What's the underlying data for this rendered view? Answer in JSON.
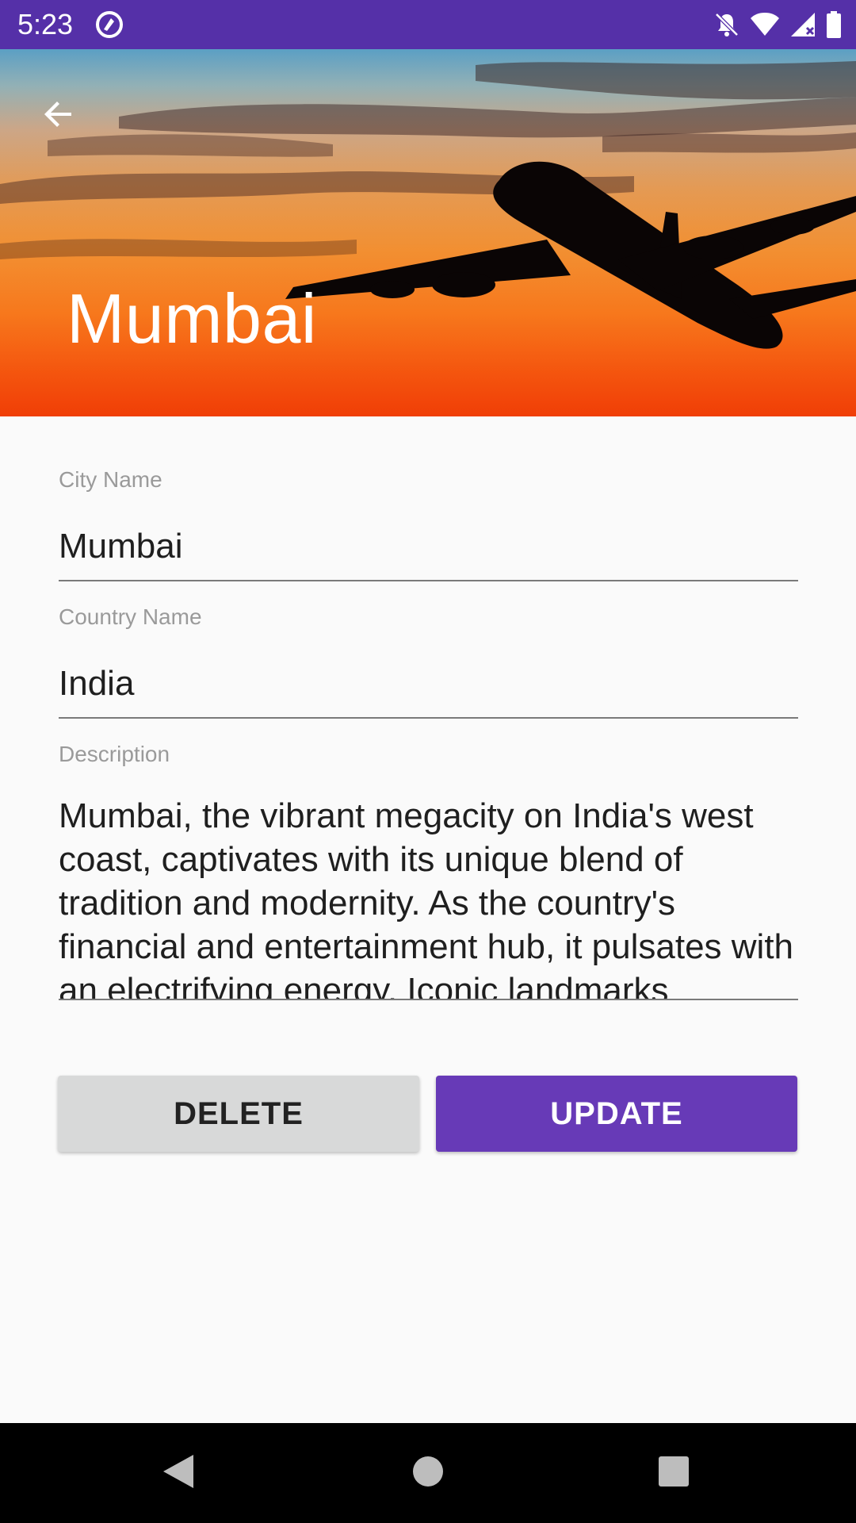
{
  "status_bar": {
    "time": "5:23",
    "icons": [
      "app-notification-icon",
      "silent-icon",
      "wifi-icon",
      "signal-icon",
      "battery-icon"
    ]
  },
  "header": {
    "title": "Mumbai",
    "back_icon": "arrow-back-icon",
    "background": "sunset-airplane-image"
  },
  "form": {
    "city": {
      "label": "City Name",
      "value": "Mumbai"
    },
    "country": {
      "label": "Country Name",
      "value": "India"
    },
    "description": {
      "label": "Description",
      "value": "Mumbai, the vibrant megacity on India's west coast, captivates with its unique blend of tradition and modernity. As the country's financial and entertainment hub, it pulsates with an electrifying energy. Iconic landmarks"
    }
  },
  "actions": {
    "delete_label": "DELETE",
    "update_label": "UPDATE"
  },
  "colors": {
    "status_bar": "#5530a8",
    "accent": "#673ab7",
    "delete_button": "#d8d9d9",
    "background": "#fafafa"
  },
  "nav_bar": {
    "icons": [
      "nav-back-icon",
      "nav-home-icon",
      "nav-recents-icon"
    ]
  }
}
